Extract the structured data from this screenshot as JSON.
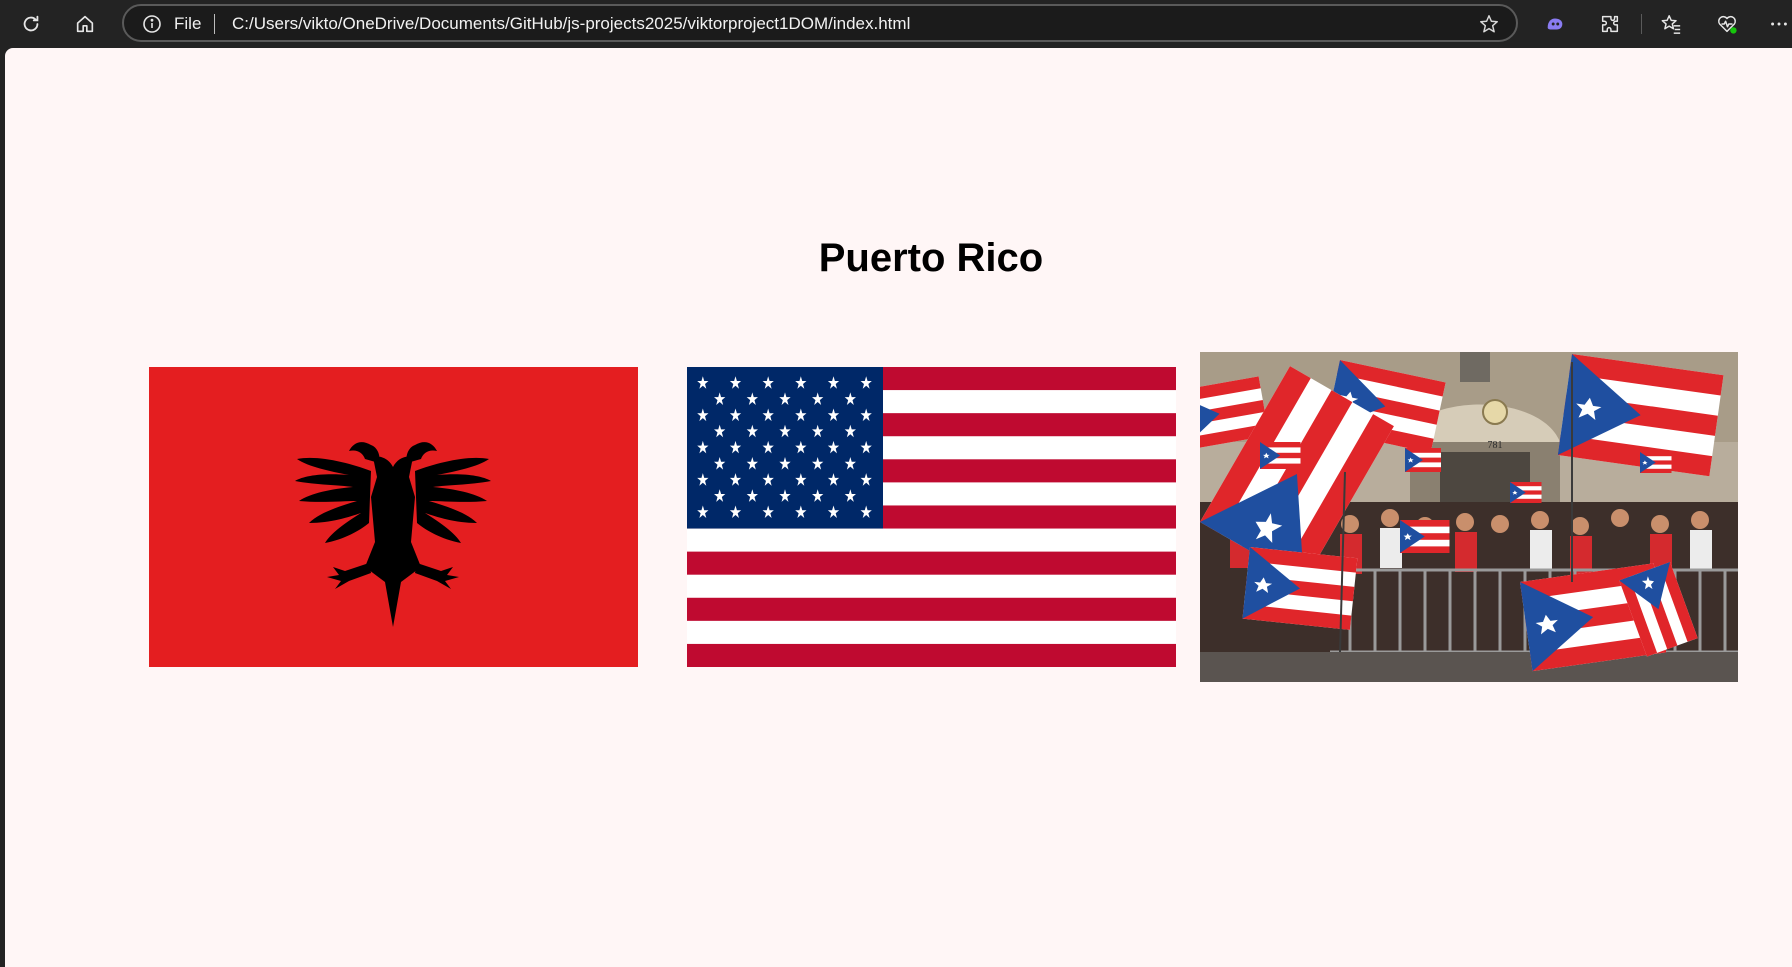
{
  "browser": {
    "address_scheme": "File",
    "url": "C:/Users/vikto/OneDrive/Documents/GitHub/js-projects2025/viktorproject1DOM/index.html",
    "icons": [
      "refresh-icon",
      "home-icon",
      "info-icon",
      "favorite-star-icon",
      "copilot-icon",
      "extensions-icon",
      "favorites-icon",
      "browser-essentials-icon",
      "more-icon"
    ]
  },
  "page": {
    "title": "Puerto Rico",
    "images": [
      {
        "name": "albania-flag",
        "colors": {
          "field": "#e41e20",
          "eagle": "#000000"
        }
      },
      {
        "name": "usa-flag",
        "colors": {
          "red": "#bf0a30",
          "white": "#ffffff",
          "blue": "#002868"
        }
      },
      {
        "name": "puerto-rico-parade-photo",
        "colors": {
          "red": "#e0262a",
          "blue": "#1f4fa0",
          "white": "#ffffff"
        },
        "sign": "781"
      }
    ],
    "background": "#fff6f6"
  }
}
